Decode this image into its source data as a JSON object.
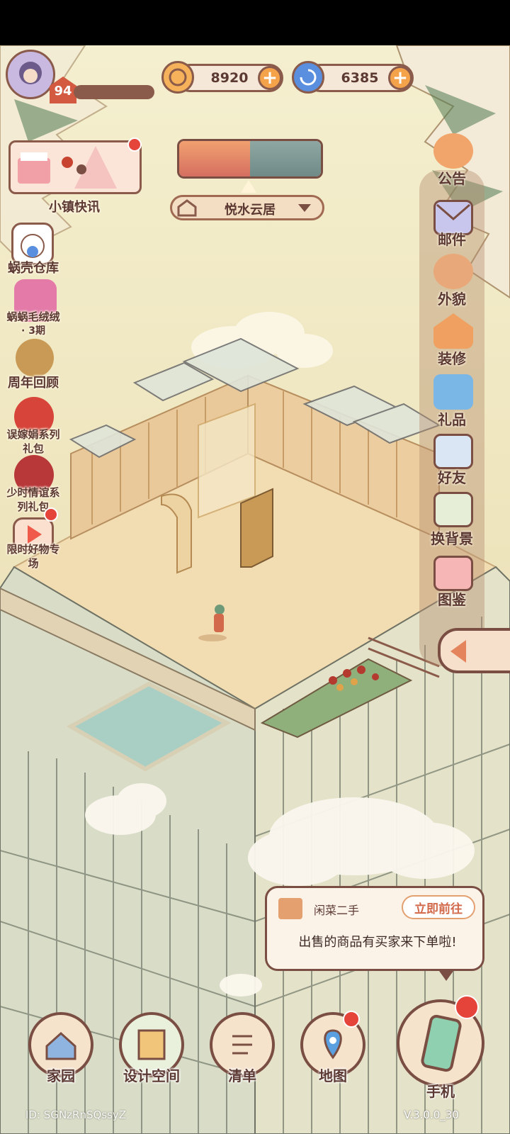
{
  "colors": {
    "accent": "#f5a34a",
    "frame": "#8a5a4a",
    "text": "#5c3a33",
    "notify": "#e5443b"
  },
  "player": {
    "level": "94"
  },
  "currency": {
    "coins": {
      "icon": "coin-icon",
      "value": "8920"
    },
    "shells": {
      "icon": "shell-swirl-icon",
      "value": "6385"
    }
  },
  "location": {
    "name": "悦水云居"
  },
  "left_menu": [
    {
      "label": "小镇快讯",
      "icon": "news-banner-icon"
    },
    {
      "label": "蜗壳仓库",
      "icon": "cat-warehouse-icon"
    },
    {
      "label": "蜗蜗毛绒绒",
      "sub": "· 3期",
      "icon": "plush-icon"
    },
    {
      "label": "周年回顾",
      "icon": "anniversary-icon"
    },
    {
      "label": "误嫁娟系列",
      "sub": "礼包",
      "icon": "rose-pack-icon"
    },
    {
      "label": "少时情谊系",
      "sub": "列礼包",
      "icon": "rose-pack-2-icon"
    },
    {
      "label": "限时好物专",
      "sub": "场",
      "icon": "video-shop-icon"
    }
  ],
  "right_menu": [
    {
      "label": "公告",
      "icon": "megaphone-icon"
    },
    {
      "label": "邮件",
      "icon": "mail-icon"
    },
    {
      "label": "外貌",
      "icon": "avatar-icon"
    },
    {
      "label": "装修",
      "icon": "house-wrench-icon"
    },
    {
      "label": "礼品",
      "icon": "gift-icon"
    },
    {
      "label": "好友",
      "icon": "friend-book-icon"
    },
    {
      "label": "换背景",
      "icon": "background-icon"
    },
    {
      "label": "图鉴",
      "icon": "album-icon"
    }
  ],
  "notification": {
    "title": "闲菜二手",
    "action": "立即前往",
    "message": "出售的商品有买家来下单啦!"
  },
  "bottom_nav": [
    {
      "label": "家园",
      "icon": "home-icon"
    },
    {
      "label": "设计空间",
      "icon": "design-icon"
    },
    {
      "label": "清单",
      "icon": "list-icon"
    },
    {
      "label": "地图",
      "icon": "map-pin-icon"
    },
    {
      "label": "手机",
      "icon": "phone-icon"
    }
  ],
  "footer": {
    "player_id": "ID: SGNzRnSQssyZ",
    "version": "V.3.0.0_30"
  }
}
